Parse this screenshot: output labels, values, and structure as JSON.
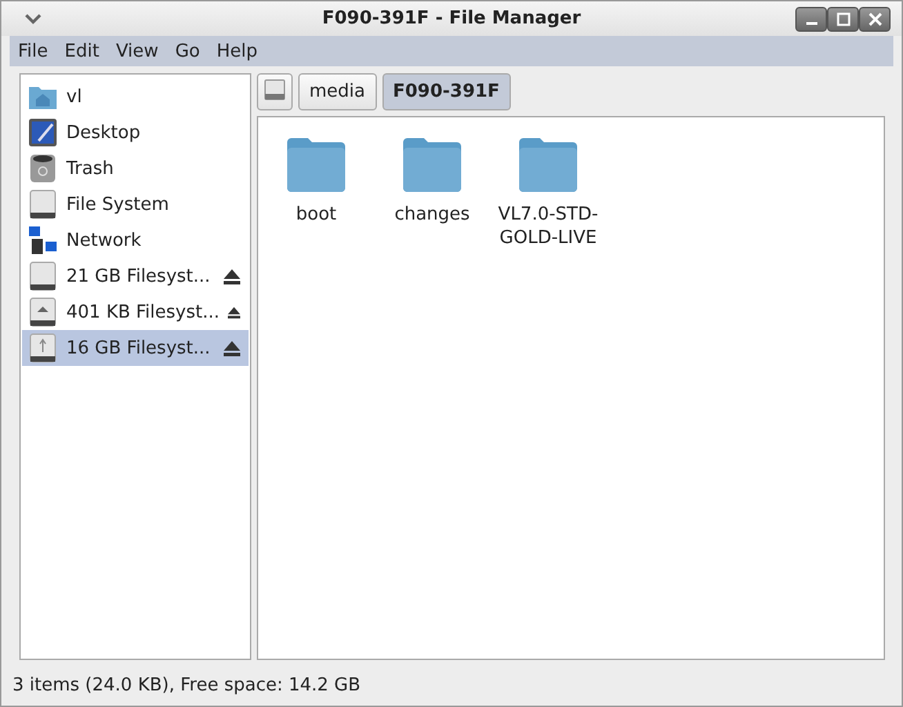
{
  "window": {
    "title": "F090-391F - File Manager"
  },
  "menu": [
    "File",
    "Edit",
    "View",
    "Go",
    "Help"
  ],
  "sidebar": {
    "items": [
      {
        "label": "vl",
        "kind": "home",
        "eject": false,
        "selected": false
      },
      {
        "label": "Desktop",
        "kind": "desktop",
        "eject": false,
        "selected": false
      },
      {
        "label": "Trash",
        "kind": "trash",
        "eject": false,
        "selected": false
      },
      {
        "label": "File System",
        "kind": "drive",
        "eject": false,
        "selected": false
      },
      {
        "label": "Network",
        "kind": "network",
        "eject": false,
        "selected": false
      },
      {
        "label": "21 GB Filesyst...",
        "kind": "drive",
        "eject": true,
        "selected": false
      },
      {
        "label": "401 KB Filesyst...",
        "kind": "removable",
        "eject": true,
        "selected": false
      },
      {
        "label": "16 GB Filesyst...",
        "kind": "usb",
        "eject": true,
        "selected": true
      }
    ]
  },
  "path": [
    {
      "label": "media",
      "selected": false
    },
    {
      "label": "F090-391F",
      "selected": true
    }
  ],
  "files": [
    {
      "name": "boot"
    },
    {
      "name": "changes"
    },
    {
      "name": "VL7.0-STD-GOLD-LIVE"
    }
  ],
  "status_bar": "3 items (24.0 KB), Free space: 14.2 GB"
}
